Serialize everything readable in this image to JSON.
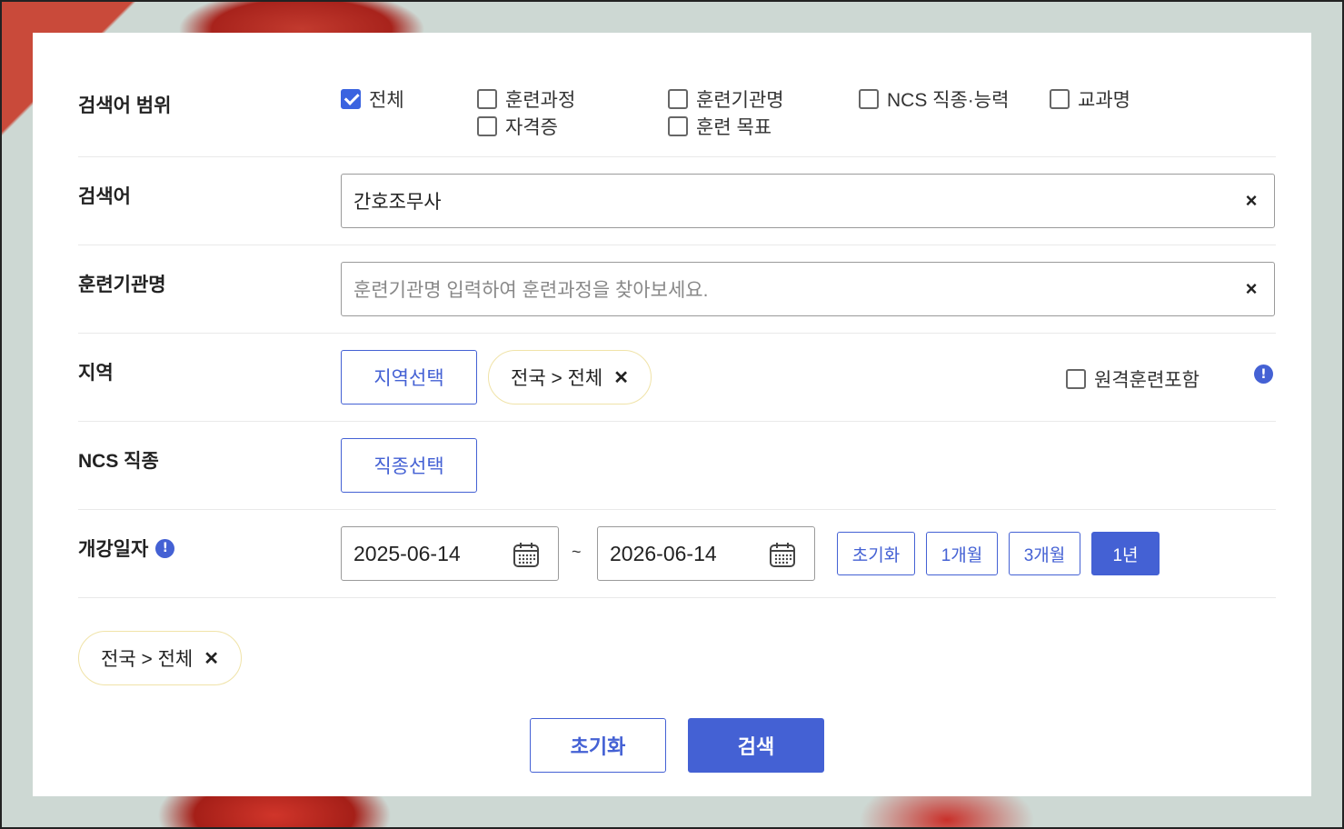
{
  "search_scope": {
    "label": "검색어 범위",
    "options": [
      {
        "label": "전체",
        "checked": true
      },
      {
        "label": "훈련과정",
        "checked": false
      },
      {
        "label": "훈련기관명",
        "checked": false
      },
      {
        "label": "NCS 직종·능력",
        "checked": false
      },
      {
        "label": "교과명",
        "checked": false
      },
      {
        "label": "자격증",
        "checked": false
      },
      {
        "label": "훈련 목표",
        "checked": false
      }
    ]
  },
  "keyword": {
    "label": "검색어",
    "value": "간호조무사",
    "clear": "×"
  },
  "institution": {
    "label": "훈련기관명",
    "placeholder": "훈련기관명 입력하여 훈련과정을 찾아보세요.",
    "clear": "×"
  },
  "region": {
    "label": "지역",
    "select_button": "지역선택",
    "chip": "전국 > 전체",
    "chip_remove": "✕",
    "remote_label": "원격훈련포함",
    "remote_checked": false,
    "info_icon": "!"
  },
  "ncs": {
    "label": "NCS 직종",
    "select_button": "직종선택"
  },
  "open_date": {
    "label": "개강일자",
    "info_icon": "!",
    "from": "2025-06-14",
    "to": "2026-06-14",
    "separator": "~",
    "presets": [
      {
        "label": "초기화",
        "active": false
      },
      {
        "label": "1개월",
        "active": false
      },
      {
        "label": "3개월",
        "active": false
      },
      {
        "label": "1년",
        "active": true
      }
    ]
  },
  "selected": {
    "chip": "전국 > 전체",
    "chip_remove": "✕"
  },
  "footer": {
    "reset": "초기화",
    "search": "검색"
  },
  "colors": {
    "accent": "#4461d4",
    "checkbox_checked": "#3a63e0",
    "chip_border": "#f0e3a8"
  }
}
